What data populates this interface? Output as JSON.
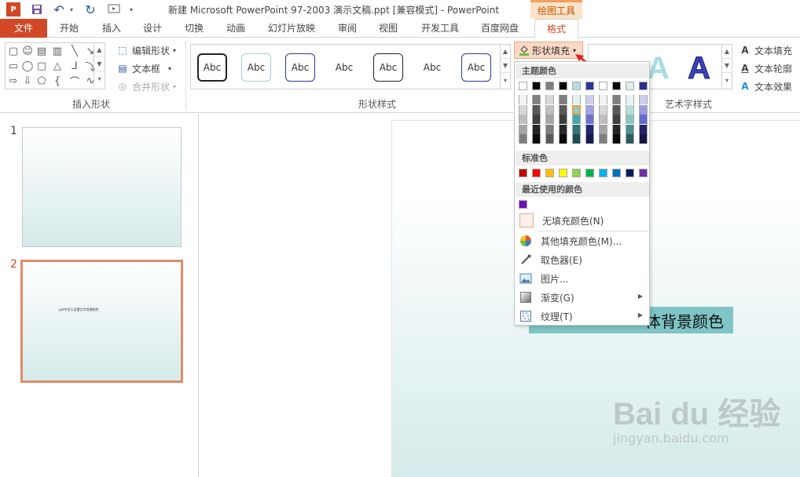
{
  "window": {
    "title": "新建 Microsoft PowerPoint 97-2003 演示文稿.ppt [兼容模式] - PowerPoint",
    "context_tab_group": "绘图工具",
    "app_icon_label": "P"
  },
  "tabs": [
    {
      "label": "文件"
    },
    {
      "label": "开始"
    },
    {
      "label": "插入"
    },
    {
      "label": "设计"
    },
    {
      "label": "切换"
    },
    {
      "label": "动画"
    },
    {
      "label": "幻灯片放映"
    },
    {
      "label": "审阅"
    },
    {
      "label": "视图"
    },
    {
      "label": "开发工具"
    },
    {
      "label": "百度网盘"
    },
    {
      "label": "格式"
    }
  ],
  "ribbon": {
    "insert_shapes": {
      "edit_shape": "编辑形状",
      "text_box": "文本框",
      "merge_shapes": "合并形状",
      "label": "插入形状"
    },
    "shape_styles": {
      "samples": [
        "Abc",
        "Abc",
        "Abc",
        "Abc",
        "Abc",
        "Abc",
        "Abc"
      ],
      "shape_fill": "形状填充",
      "label": "形状样式"
    },
    "wordart": {
      "sample": "A",
      "text_fill": "文本填充",
      "text_outline": "文本轮廓",
      "text_effects": "文本效果",
      "label": "艺术字样式"
    }
  },
  "slides": {
    "thumb_numbers": [
      "1",
      "2"
    ],
    "selected": 2,
    "current_text": "体背景颜色",
    "thumb_text": "ppt中怎么设置文字背景颜色"
  },
  "dropdown": {
    "theme_colors_header": "主题颜色",
    "standard_colors_header": "标准色",
    "recent_colors_header": "最近使用的颜色",
    "no_fill": "无填充颜色(N)",
    "more_colors": "其他填充颜色(M)...",
    "eyedropper": "取色器(E)",
    "picture": "图片...",
    "gradient": "渐变(G)",
    "texture": "纹理(T)",
    "theme_top": [
      "#ffffff",
      "#000000",
      "#7f7f7f",
      "#000000",
      "#b8dde0",
      "#2f3699",
      "#ffffff",
      "#000000",
      "#ddeeee",
      "#2c2d8e"
    ],
    "theme_shades": [
      [
        "#f2f2f2",
        "#d8d8d8",
        "#bfbfbf",
        "#a5a5a5",
        "#7f7f7f"
      ],
      [
        "#7f7f7f",
        "#595959",
        "#3f3f3f",
        "#262626",
        "#0c0c0c"
      ],
      [
        "#d8d8d8",
        "#bfbfbf",
        "#a5a5a5",
        "#7f7f7f",
        "#595959"
      ],
      [
        "#7f7f7f",
        "#595959",
        "#3f3f3f",
        "#262626",
        "#0c0c0c"
      ],
      [
        "#e2f1f2",
        "#8fcbd0",
        "#4aa6ac",
        "#307479",
        "#1f4c4f"
      ],
      [
        "#cfd0ee",
        "#9fa2de",
        "#6e72ce",
        "#232774",
        "#171a4d"
      ],
      [
        "#f2f2f2",
        "#d8d8d8",
        "#bfbfbf",
        "#a5a5a5",
        "#7f7f7f"
      ],
      [
        "#7f7f7f",
        "#595959",
        "#3f3f3f",
        "#262626",
        "#0c0c0c"
      ],
      [
        "#e8f3f3",
        "#b9dcdc",
        "#8bc5c5",
        "#4c8f8f",
        "#2f5a5a"
      ],
      [
        "#cccdef",
        "#9a9cdf",
        "#6769cf",
        "#212269",
        "#161746"
      ]
    ],
    "standard": [
      "#c00000",
      "#ff0000",
      "#ffc000",
      "#ffff00",
      "#92d050",
      "#00b050",
      "#00b0f0",
      "#0070c0",
      "#002060",
      "#7030a0"
    ],
    "recent": [
      "#6a0dbf"
    ]
  },
  "watermark": {
    "logo": "Bai du 经验",
    "url": "jingyan.baidu.com"
  },
  "colors": {
    "accent": "#d24726",
    "fill_button_bg": "#fbd9c5",
    "textbox_bg": "#7fc4c6"
  }
}
